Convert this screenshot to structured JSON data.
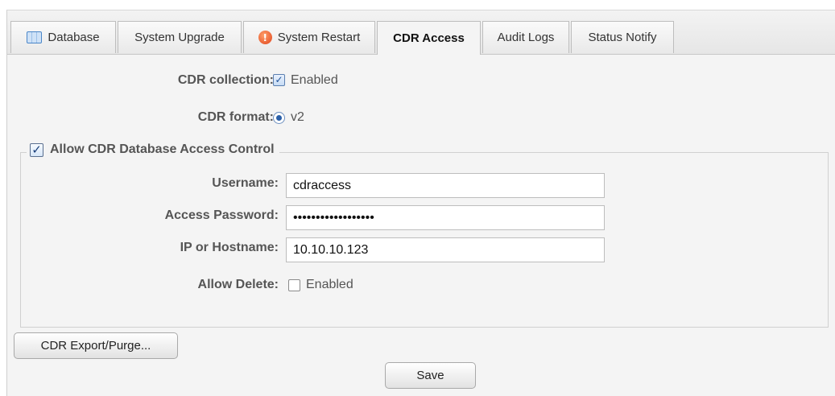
{
  "tabs": [
    {
      "label": "Database",
      "icon": "database-icon"
    },
    {
      "label": "System Upgrade"
    },
    {
      "label": "System Restart",
      "icon": "warning-icon"
    },
    {
      "label": "CDR Access",
      "active": true
    },
    {
      "label": "Audit Logs"
    },
    {
      "label": "Status Notify"
    }
  ],
  "cdr_collection": {
    "label": "CDR collection:",
    "checked": true,
    "option_label": "Enabled"
  },
  "cdr_format": {
    "label": "CDR format:",
    "selected": "v2"
  },
  "access_control": {
    "legend": "Allow CDR Database Access Control",
    "checked": true,
    "username": {
      "label": "Username:",
      "value": "cdraccess"
    },
    "password": {
      "label": "Access Password:",
      "value": "••••••••••••••••••"
    },
    "host": {
      "label": "IP or Hostname:",
      "value": "10.10.10.123"
    },
    "allow_delete": {
      "label": "Allow Delete:",
      "checked": false,
      "option_label": "Enabled"
    }
  },
  "buttons": {
    "export": "CDR Export/Purge...",
    "save": "Save"
  }
}
